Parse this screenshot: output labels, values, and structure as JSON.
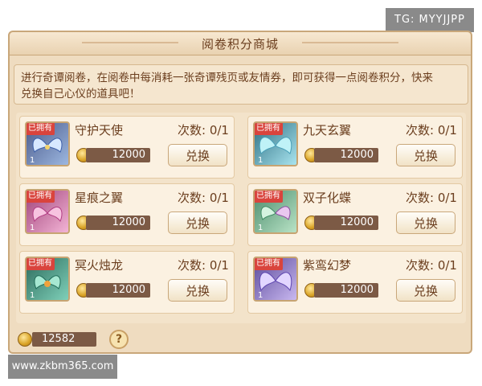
{
  "watermark_tg": "TG: MYYJJPP",
  "watermark_url": "www.zkbm365.com",
  "panel": {
    "title": "阅卷积分商城",
    "description_line1": "进行奇谭阅卷，在阅卷中每消耗一张奇谭残页或友情券，即可获得一点阅卷积分，快来",
    "description_line2": "兑换自己心仪的道具吧！"
  },
  "items": [
    {
      "name": "守护天使",
      "owned_label": "已拥有",
      "count_label": "次数: 0/1",
      "price": "12000",
      "button": "兑换",
      "qty": "1"
    },
    {
      "name": "九天玄翼",
      "owned_label": "已拥有",
      "count_label": "次数: 0/1",
      "price": "12000",
      "button": "兑换",
      "qty": "1"
    },
    {
      "name": "星痕之翼",
      "owned_label": "已拥有",
      "count_label": "次数: 0/1",
      "price": "12000",
      "button": "兑换",
      "qty": "1"
    },
    {
      "name": "双子化蝶",
      "owned_label": "已拥有",
      "count_label": "次数: 0/1",
      "price": "12000",
      "button": "兑换",
      "qty": "1"
    },
    {
      "name": "冥火烛龙",
      "owned_label": "已拥有",
      "count_label": "次数: 0/1",
      "price": "12000",
      "button": "兑换",
      "qty": "1"
    },
    {
      "name": "紫鸾幻梦",
      "owned_label": "已拥有",
      "count_label": "次数: 0/1",
      "price": "12000",
      "button": "兑换",
      "qty": "1"
    }
  ],
  "footer": {
    "balance": "12582",
    "help_label": "?"
  },
  "colors": {
    "panel_bg": "#efdcc0",
    "owned_badge": "#d9443d",
    "price_bar": "#7c5a45",
    "text_brown": "#6b3e1e"
  },
  "icons": [
    "coin-icon",
    "help-icon",
    "wing-icon"
  ]
}
